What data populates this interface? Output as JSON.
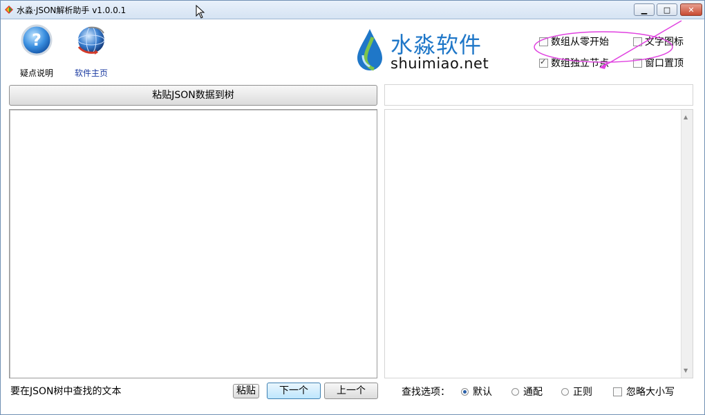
{
  "window": {
    "title": "水淼·JSON解析助手 v1.0.0.1",
    "controls": {
      "minimize": "▁",
      "maximize": "□",
      "close": "✕"
    }
  },
  "toolbar": {
    "help_label": "疑点说明",
    "home_label": "软件主页"
  },
  "logo": {
    "cn": "水淼软件",
    "en": "shuimiao.net",
    "accent": "#1f77c8"
  },
  "options": {
    "array_zero": {
      "label": "数组从零开始",
      "checked": false
    },
    "text_icon": {
      "label": "文字图标",
      "checked": false
    },
    "array_node": {
      "label": "数组独立节点",
      "checked": true
    },
    "topmost": {
      "label": "窗口置顶",
      "checked": false
    }
  },
  "main": {
    "paste_json_label": "粘贴JSON数据到树"
  },
  "search": {
    "value": "要在JSON树中查找的文本",
    "paste_label": "粘贴",
    "next_label": "下一个",
    "prev_label": "上一个",
    "options_label": "查找选项：",
    "modes": [
      {
        "label": "默认",
        "selected": true
      },
      {
        "label": "通配",
        "selected": false
      },
      {
        "label": "正则",
        "selected": false
      }
    ],
    "ignore_case": {
      "label": "忽略大小写",
      "checked": false
    }
  }
}
